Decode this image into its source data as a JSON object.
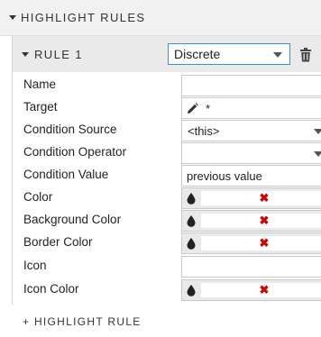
{
  "section": {
    "title": "HIGHLIGHT RULES",
    "caret_icon": "caret-down-icon"
  },
  "rule": {
    "title": "RULE 1",
    "type_select": {
      "value": "Discrete",
      "arrow_icon": "chevron-down-icon"
    },
    "delete_icon": "trash-icon"
  },
  "fields": {
    "name": {
      "label": "Name",
      "value": ""
    },
    "target": {
      "label": "Target",
      "icon": "pencil-icon",
      "value": "*"
    },
    "condition_source": {
      "label": "Condition Source",
      "value": "<this>"
    },
    "condition_operator": {
      "label": "Condition Operator",
      "value": ""
    },
    "condition_value": {
      "label": "Condition Value",
      "value": "previous value"
    },
    "color": {
      "label": "Color",
      "swatch_value": "✖"
    },
    "background_color": {
      "label": "Background Color",
      "swatch_value": "✖"
    },
    "border_color": {
      "label": "Border Color",
      "swatch_value": "✖"
    },
    "icon": {
      "label": "Icon",
      "value": ""
    },
    "icon_color": {
      "label": "Icon Color",
      "swatch_value": "✖"
    }
  },
  "add_rule_label": "+ HIGHLIGHT RULE",
  "colors": {
    "accent_border": "#3f8ed8",
    "clear_x": "#d40000",
    "header_bg": "#f1f1f1",
    "rule_header_bg": "#eaeaea"
  }
}
